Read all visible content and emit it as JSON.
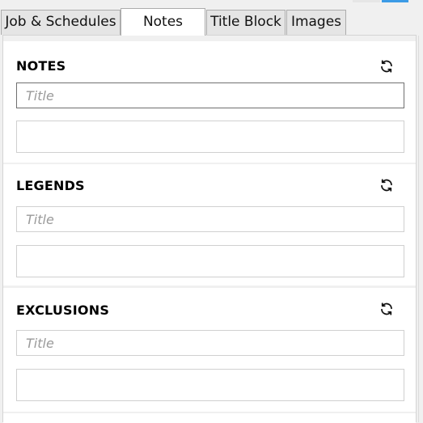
{
  "tabs": [
    {
      "label": "Job & Schedules",
      "active": false
    },
    {
      "label": "Notes",
      "active": true
    },
    {
      "label": "Title Block",
      "active": false
    },
    {
      "label": "Images",
      "active": false
    }
  ],
  "sections": [
    {
      "heading": "NOTES",
      "title_placeholder": "Title",
      "title_value": "",
      "body_value": "",
      "refresh_icon": "refresh-icon"
    },
    {
      "heading": "LEGENDS",
      "title_placeholder": "Title",
      "title_value": "",
      "body_value": "",
      "refresh_icon": "refresh-icon"
    },
    {
      "heading": "EXCLUSIONS",
      "title_placeholder": "Title",
      "title_value": "",
      "body_value": "",
      "refresh_icon": "refresh-icon"
    }
  ],
  "colors": {
    "accent": "#3c9be6",
    "tab_active_bg": "#ffffff",
    "tab_inactive_bg": "#e5e5e5",
    "panel_bg": "#f0f0f0"
  }
}
